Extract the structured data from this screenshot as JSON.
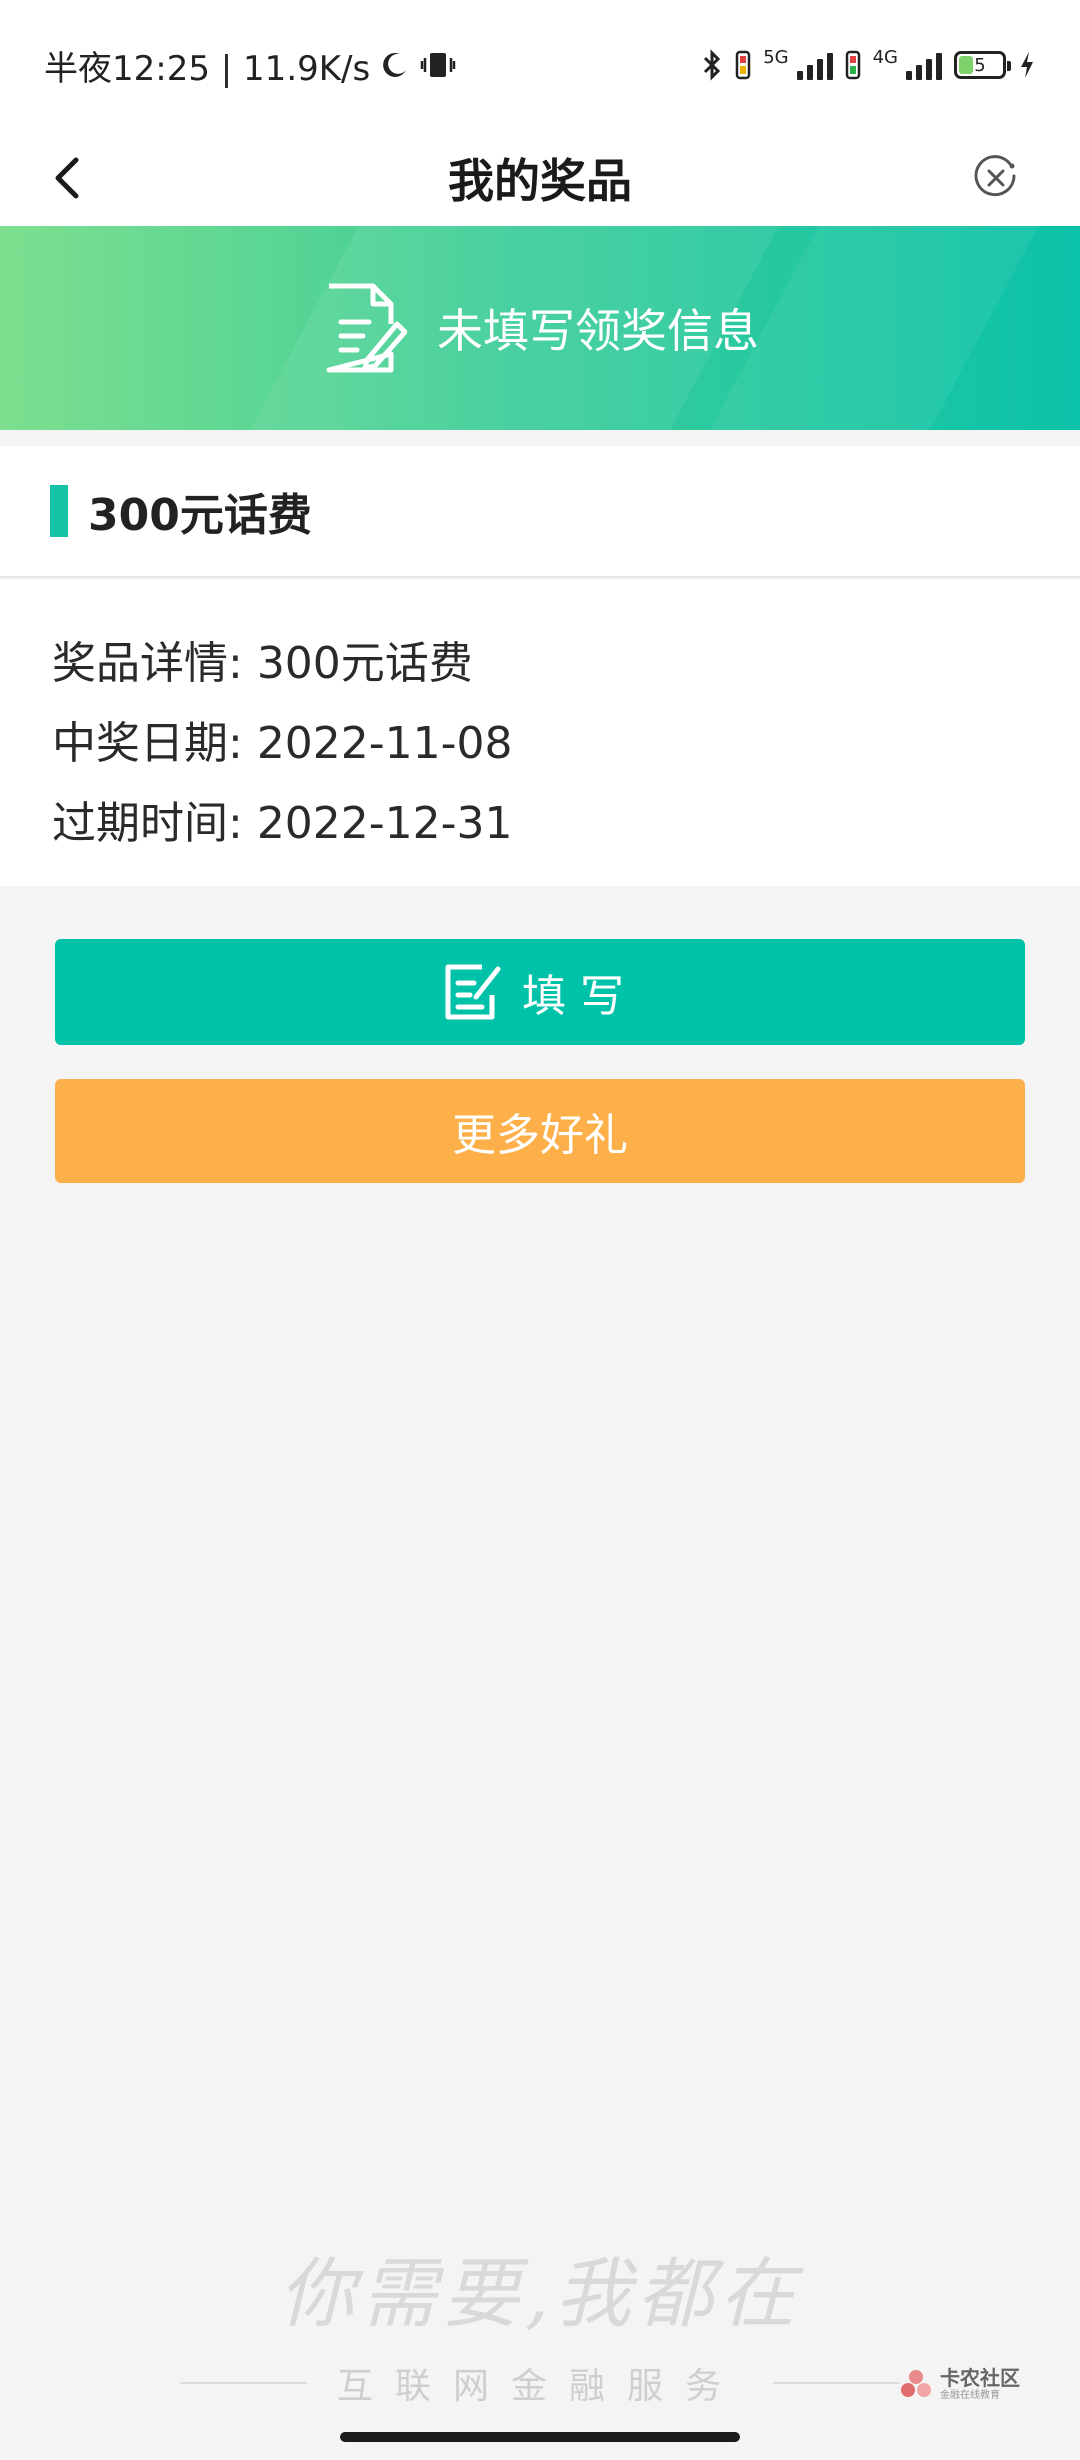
{
  "status_bar": {
    "time": "半夜12:25 | 11.9K/s",
    "net_5g": "5G",
    "net_4g": "4G",
    "battery": "5",
    "icons": [
      "moon-icon",
      "vibrate-icon",
      "bluetooth-icon",
      "sim-icon",
      "signal-icon",
      "battery-icon",
      "charging-icon"
    ]
  },
  "nav": {
    "title": "我的奖品",
    "back_icon": "chevron-left-icon",
    "close_icon": "close-circle-icon"
  },
  "banner": {
    "text": "未填写领奖信息",
    "icon": "document-edit-icon"
  },
  "prize": {
    "name": "300元话费",
    "details": [
      {
        "label": "奖品详情: ",
        "value": "300元话费"
      },
      {
        "label": "中奖日期: ",
        "value": "2022-11-08"
      },
      {
        "label": "过期时间: ",
        "value": "2022-12-31"
      }
    ]
  },
  "buttons": {
    "fill_label": "填写",
    "fill_icon": "edit-icon",
    "more_label": "更多好礼"
  },
  "footer": {
    "slogan": "你需要,我都在",
    "service": "互联网金融服务",
    "logo_name": "卡农社区",
    "logo_sub": "金融在线教育"
  },
  "colors": {
    "accent": "#00c2a8",
    "orange": "#fdb04a",
    "banner_start": "#7ddf8f",
    "banner_end": "#0cc2a9"
  }
}
